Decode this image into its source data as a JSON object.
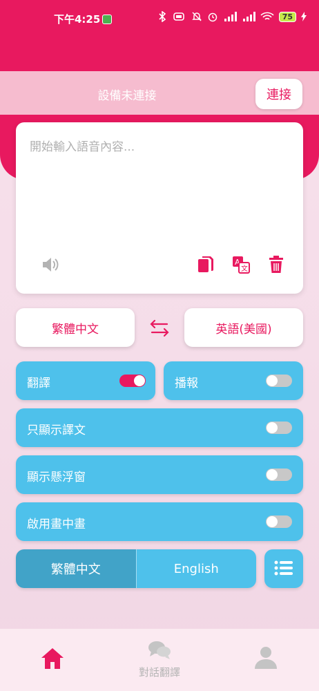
{
  "status_bar": {
    "time": "下午4:25",
    "battery": "75"
  },
  "connection": {
    "status_text": "設備未連接",
    "connect_label": "連接"
  },
  "input": {
    "placeholder": "開始輸入語音內容...",
    "value": ""
  },
  "icons": {
    "speaker": "speaker-icon",
    "copy": "copy-icon",
    "translate": "translate-icon",
    "delete": "trash-icon",
    "swap": "swap-icon",
    "list": "list-icon",
    "home": "home-icon",
    "chat": "chat-icon",
    "profile": "profile-icon"
  },
  "languages": {
    "source": "繁體中文",
    "target": "英語(美國)"
  },
  "toggles": {
    "translate": {
      "label": "翻譯",
      "on": true
    },
    "broadcast": {
      "label": "播報",
      "on": false
    },
    "only_translation": {
      "label": "只顯示譯文",
      "on": false
    },
    "floating_window": {
      "label": "顯示懸浮窗",
      "on": false
    },
    "picture_in_picture": {
      "label": "啟用畫中畫",
      "on": false
    }
  },
  "display_language": {
    "option_a": "繁體中文",
    "option_b": "English",
    "selected": "繁體中文"
  },
  "bottom_nav": {
    "chat_label": "對話翻譯"
  },
  "colors": {
    "brand": "#e8195f",
    "accent_blue": "#4ec1eb",
    "accent_blue_dark": "#41a3c8"
  }
}
